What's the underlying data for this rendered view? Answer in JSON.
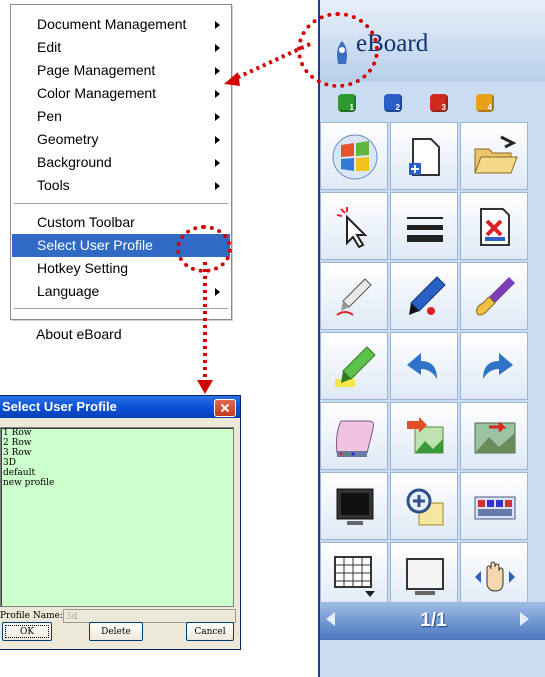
{
  "menu": {
    "items": [
      {
        "label": "Document Management",
        "submenu": true
      },
      {
        "label": "Edit",
        "submenu": true
      },
      {
        "label": "Page Management",
        "submenu": true
      },
      {
        "label": "Color Management",
        "submenu": true
      },
      {
        "label": "Pen",
        "submenu": true
      },
      {
        "label": "Geometry",
        "submenu": true
      },
      {
        "label": "Background",
        "submenu": true
      },
      {
        "label": "Tools",
        "submenu": true
      },
      {
        "label": "Custom Toolbar",
        "submenu": false
      },
      {
        "label": "Select User Profile",
        "submenu": true,
        "selected": true
      },
      {
        "label": "Hotkey Setting",
        "submenu": false
      },
      {
        "label": "Language",
        "submenu": true
      },
      {
        "label": "About eBoard",
        "submenu": false
      }
    ]
  },
  "dialog": {
    "title": "Select User Profile",
    "profiles": [
      "1 Row",
      "2 Row",
      "3 Row",
      "3D",
      "default",
      "new profile"
    ],
    "profile_name_label": "Profile Name:",
    "profile_name_value": "3d",
    "ok_label": "OK",
    "delete_label": "Delete",
    "cancel_label": "Cancel"
  },
  "eboard": {
    "app_name": "eBoard",
    "tabs": [
      {
        "number": "1",
        "color": "#2e9a2e"
      },
      {
        "number": "2",
        "color": "#2a5fc8"
      },
      {
        "number": "3",
        "color": "#d02a1c"
      },
      {
        "number": "4",
        "color": "#e8a21a"
      }
    ],
    "tools": [
      "windows-logo-icon",
      "new-page-icon",
      "open-folder-icon",
      "select-arrow-icon",
      "line-width-icon",
      "delete-page-icon",
      "pen-red-icon",
      "marker-blue-icon",
      "brush-icon",
      "highlighter-green-icon",
      "undo-icon",
      "redo-icon",
      "eraser-icon",
      "insert-picture-icon",
      "background-picture-icon",
      "screen-icon",
      "magnifier-icon",
      "keyboard-icon",
      "grid-layout-icon",
      "blank-screen-icon",
      "pan-hand-icon"
    ],
    "page_indicator": "1/1"
  },
  "colors": {
    "annotation_red": "#d40000",
    "menu_highlight": "#316ac5",
    "list_background": "#ccffcc"
  }
}
